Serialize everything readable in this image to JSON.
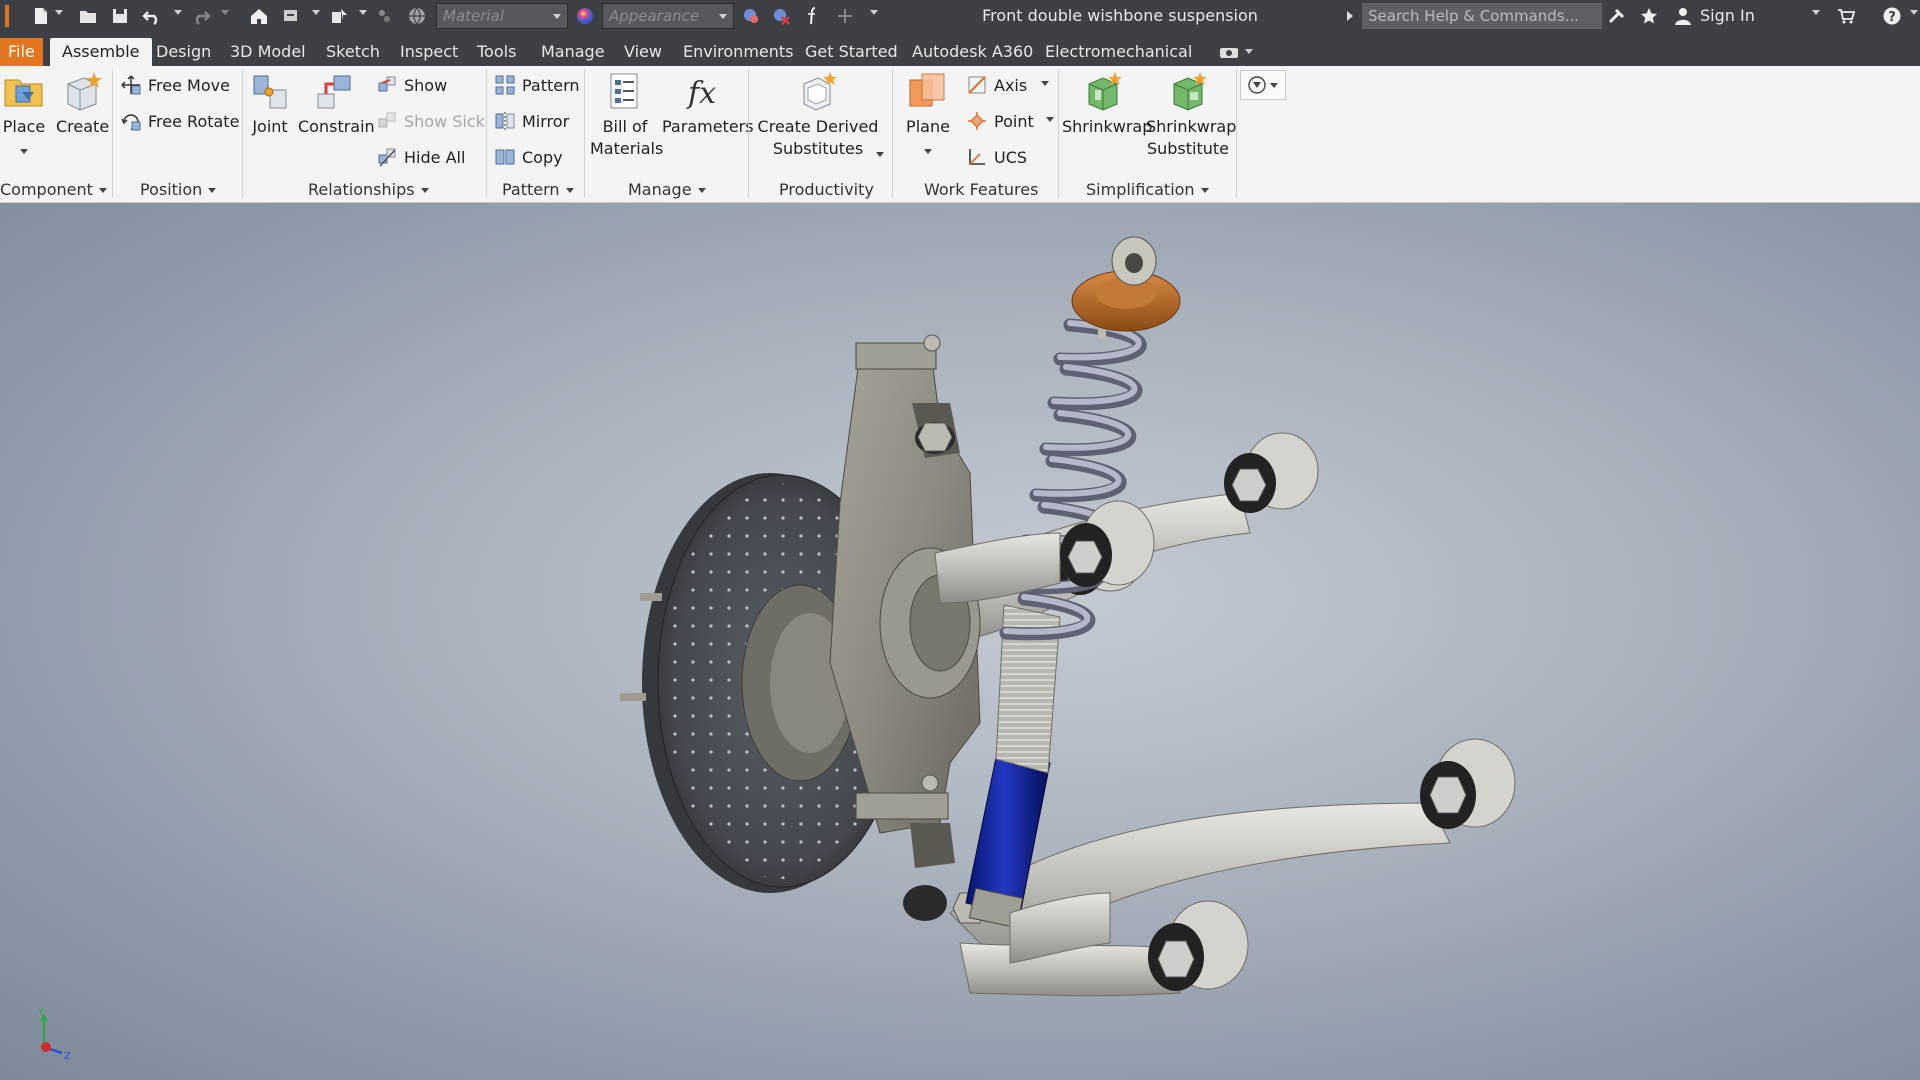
{
  "titlebar": {
    "material_placeholder": "Material",
    "appearance_placeholder": "Appearance",
    "document_title": "Front double wishbone suspension",
    "search_placeholder": "Search Help & Commands...",
    "sign_in": "Sign In"
  },
  "tabs": {
    "file": "File",
    "items": [
      "Assemble",
      "Design",
      "3D Model",
      "Sketch",
      "Inspect",
      "Tools",
      "Manage",
      "View",
      "Environments",
      "Get Started",
      "Autodesk A360",
      "Electromechanical"
    ],
    "active": "Assemble"
  },
  "ribbon": {
    "component": {
      "label": "Component",
      "place": "Place",
      "create": "Create"
    },
    "position": {
      "label": "Position",
      "free_move": "Free Move",
      "free_rotate": "Free Rotate"
    },
    "relationships": {
      "label": "Relationships",
      "joint": "Joint",
      "constrain": "Constrain",
      "show": "Show",
      "show_sick": "Show Sick",
      "hide_all": "Hide All"
    },
    "pattern": {
      "label": "Pattern",
      "pattern": "Pattern",
      "mirror": "Mirror",
      "copy": "Copy"
    },
    "manage": {
      "label": "Manage",
      "bom_line1": "Bill of",
      "bom_line2": "Materials",
      "parameters": "Parameters"
    },
    "productivity": {
      "label": "Productivity",
      "derived_line1": "Create Derived",
      "derived_line2": "Substitutes"
    },
    "work_features": {
      "label": "Work Features",
      "plane": "Plane",
      "axis": "Axis",
      "point": "Point",
      "ucs": "UCS"
    },
    "simplification": {
      "label": "Simplification",
      "shrinkwrap": "Shrinkwrap",
      "shrinkwrap_sub_line1": "Shrinkwrap",
      "shrinkwrap_sub_line2": "Substitute"
    }
  },
  "viewport": {
    "triad_labels": {
      "y": "Y",
      "z": "Z"
    }
  },
  "colors": {
    "titlebar_bg": "#3d4145",
    "file_tab": "#e3761f",
    "ribbon_bg": "#f4f4f4",
    "damper_blue": "#0a1a8c",
    "spring_gray": "#8e92a2",
    "spring_seat": "#b4661e"
  }
}
